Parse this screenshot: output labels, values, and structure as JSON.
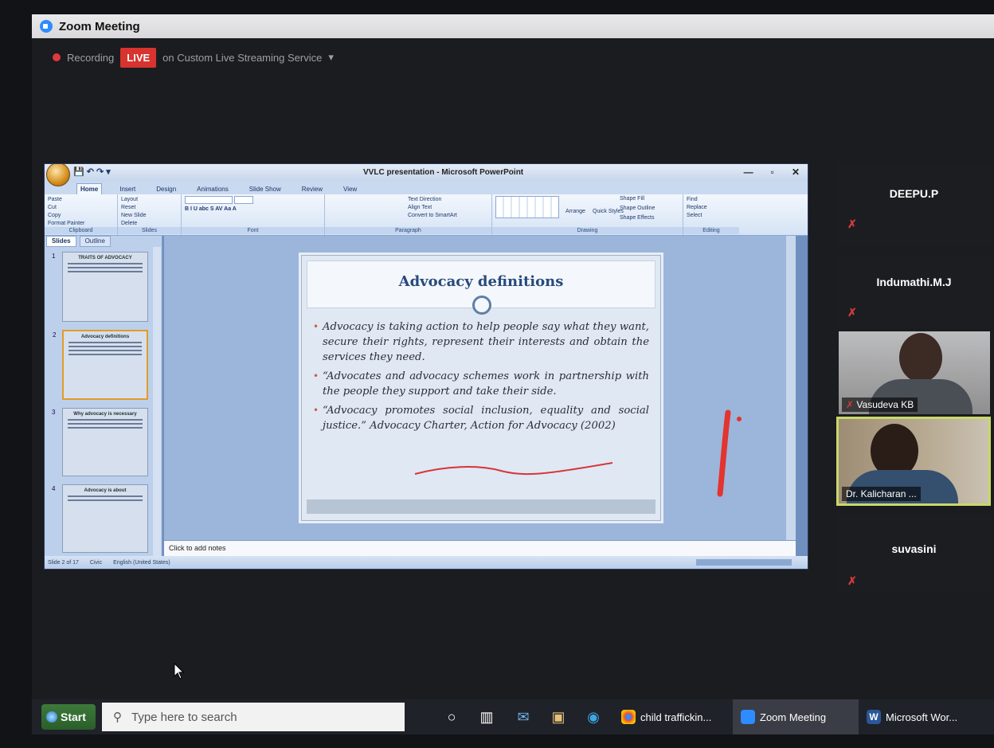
{
  "zoom": {
    "window_title": "Zoom Meeting",
    "recording_label": "Recording",
    "live_badge": "LIVE",
    "stream_label": "on Custom Live Streaming Service"
  },
  "powerpoint": {
    "window_title": "VVLC presentation - Microsoft PowerPoint",
    "tabs": [
      "Home",
      "Insert",
      "Design",
      "Animations",
      "Slide Show",
      "Review",
      "View"
    ],
    "ribbon_groups": {
      "clipboard": {
        "label": "Clipboard",
        "paste": "Paste",
        "cut": "Cut",
        "copy": "Copy",
        "format_painter": "Format Painter"
      },
      "slides": {
        "label": "Slides",
        "new_slide": "New Slide",
        "layout": "Layout",
        "reset": "Reset",
        "delete": "Delete"
      },
      "font": {
        "label": "Font"
      },
      "paragraph": {
        "label": "Paragraph",
        "text_direction": "Text Direction",
        "align_text": "Align Text",
        "convert_smartart": "Convert to SmartArt"
      },
      "drawing": {
        "label": "Drawing",
        "arrange": "Arrange",
        "quick_styles": "Quick Styles",
        "shape_fill": "Shape Fill",
        "shape_outline": "Shape Outline",
        "shape_effects": "Shape Effects"
      },
      "editing": {
        "label": "Editing",
        "find": "Find",
        "replace": "Replace",
        "select": "Select"
      }
    },
    "pane_tabs": [
      "Slides",
      "Outline"
    ],
    "thumbnails": [
      {
        "num": "1",
        "title": "TRAITS OF ADVOCACY"
      },
      {
        "num": "2",
        "title": "Advocacy definitions"
      },
      {
        "num": "3",
        "title": "Why advocacy is necessary"
      },
      {
        "num": "4",
        "title": "Advocacy is about"
      }
    ],
    "slide": {
      "title": "Advocacy definitions",
      "bullets": [
        "Advocacy is taking action to help people say what they want, secure their rights, represent their interests and obtain the services they need.",
        "“Advocates and advocacy schemes work in partnership with the people they support and take their side.",
        "“Advocacy promotes social inclusion, equality and social justice.” Advocacy Charter, Action for Advocacy (2002)"
      ]
    },
    "notes_placeholder": "Click to add notes",
    "status": {
      "slide_count": "Slide 2 of 17",
      "theme": "Civic",
      "language": "English (United States)"
    }
  },
  "participants": [
    {
      "name": "DEEPU.P",
      "muted": true,
      "video": false
    },
    {
      "name": "Indumathi.M.J",
      "muted": true,
      "video": false
    },
    {
      "name": "Vasudeva KB",
      "muted": true,
      "video": true
    },
    {
      "name": "Dr. Kalicharan ...",
      "muted": false,
      "video": true,
      "active_speaker": true
    },
    {
      "name": "suvasini",
      "muted": true,
      "video": false
    }
  ],
  "taskbar": {
    "start_label": "Start",
    "search_placeholder": "Type here to search",
    "apps": [
      {
        "label": "child traffickin...",
        "icon": "chrome-icon"
      },
      {
        "label": "Zoom Meeting",
        "icon": "zoom-icon"
      },
      {
        "label": "Microsoft Wor...",
        "icon": "word-icon"
      }
    ]
  },
  "colors": {
    "live": "#d7332f",
    "muted": "#d33b3b",
    "active_speaker_border": "#c9d86a",
    "slide_title": "#284a7d",
    "zoom_blue": "#2d8cff"
  }
}
